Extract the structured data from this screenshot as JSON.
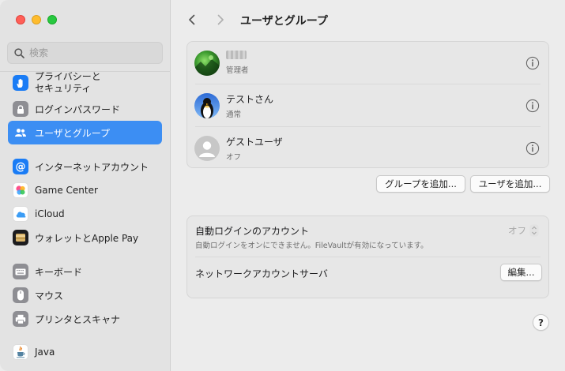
{
  "window": {
    "traffic_lights": [
      "close",
      "minimize",
      "zoom"
    ]
  },
  "sidebar": {
    "search_placeholder": "検索",
    "items": [
      {
        "label": "プライバシーと\nセキュリティ",
        "icon": "hand-icon",
        "color": "#1a7cf5"
      },
      {
        "label": "ログインパスワード",
        "icon": "lock-icon",
        "color": "#8e8e93"
      },
      {
        "label": "ユーザとグループ",
        "icon": "users-icon",
        "color": "#1a7cf5",
        "active": true
      },
      {
        "label": "インターネットアカウント",
        "icon": "at-icon",
        "color": "#1a7cf5"
      },
      {
        "label": "Game Center",
        "icon": "game-center-icon",
        "color": "#ffffff"
      },
      {
        "label": "iCloud",
        "icon": "cloud-icon",
        "color": "#ffffff"
      },
      {
        "label": "ウォレットとApple Pay",
        "icon": "wallet-icon",
        "color": "#1c1c1e"
      },
      {
        "label": "キーボード",
        "icon": "keyboard-icon",
        "color": "#8e8e93"
      },
      {
        "label": "マウス",
        "icon": "mouse-icon",
        "color": "#8e8e93"
      },
      {
        "label": "プリンタとスキャナ",
        "icon": "printer-icon",
        "color": "#8e8e93"
      },
      {
        "label": "Java",
        "icon": "java-icon",
        "color": "#ffffff"
      }
    ]
  },
  "header": {
    "title": "ユーザとグループ",
    "back_icon": "chevron-left-icon",
    "forward_icon": "chevron-right-icon"
  },
  "users": [
    {
      "name": "",
      "role": "管理者",
      "avatar": "green-landscape-avatar"
    },
    {
      "name": "テストさん",
      "role": "通常",
      "avatar": "penguin-avatar"
    },
    {
      "name": "ゲストユーザ",
      "role": "オフ",
      "avatar": "generic-person-avatar"
    }
  ],
  "actions": {
    "add_group": "グループを追加...",
    "add_user": "ユーザを追加..."
  },
  "auto_login": {
    "title": "自動ログインのアカウント",
    "description": "自動ログインをオンにできません。FileVaultが有効になっています。",
    "value": "オフ"
  },
  "network_server": {
    "title": "ネットワークアカウントサーバ",
    "edit": "編集..."
  },
  "help": "?"
}
